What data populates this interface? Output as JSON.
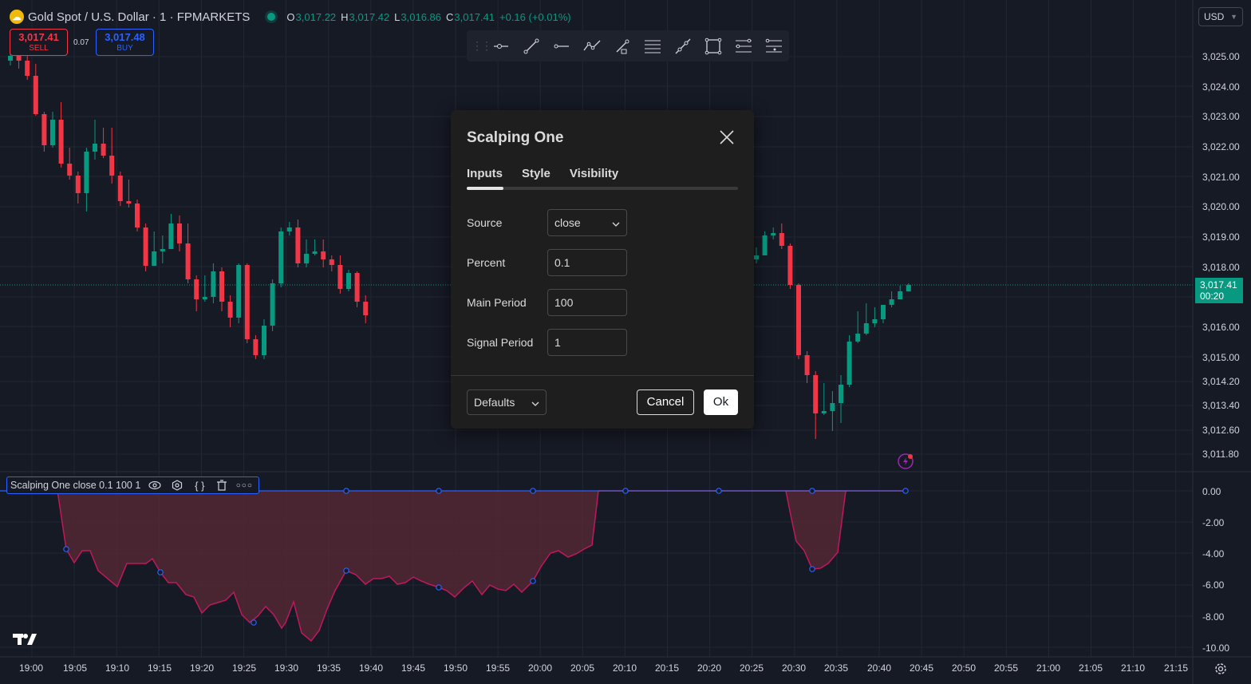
{
  "header": {
    "logo_letter": "☁",
    "title": "Gold Spot / U.S. Dollar · 1 · FPMARKETS",
    "ohlc": [
      {
        "k": "O",
        "v": "3,017.22"
      },
      {
        "k": "H",
        "v": "3,017.42"
      },
      {
        "k": "L",
        "v": "3,016.86"
      },
      {
        "k": "C",
        "v": "3,017.41"
      }
    ],
    "change": "+0.16 (+0.01%)"
  },
  "currency": "USD",
  "trade": {
    "sell_price": "3,017.41",
    "sell_label": "SELL",
    "spread": "0.07",
    "buy_price": "3,017.48",
    "buy_label": "BUY"
  },
  "drawing_toolbar": {
    "tools": [
      "horizontal-ray-icon",
      "trend-line-icon",
      "horizontal-line-icon",
      "path-icon",
      "ray-icon",
      "parallel-channel-icon",
      "extended-line-icon",
      "rectangle-icon",
      "fib-retracement-icon",
      "gann-icon"
    ]
  },
  "price_axis": [
    "3,025.00",
    "3,024.00",
    "3,023.00",
    "3,022.00",
    "3,021.00",
    "3,020.00",
    "3,019.00",
    "3,018.00",
    "3,016.00",
    "3,015.00",
    "3,014.20",
    "3,013.40",
    "3,012.60",
    "3,011.80"
  ],
  "price_tag": {
    "price": "3,017.41",
    "countdown": "00:20"
  },
  "indicator_axis": [
    "0.00",
    "-2.00",
    "-4.00",
    "-6.00",
    "-8.00",
    "-10.00"
  ],
  "time_axis": [
    "19:00",
    "19:05",
    "19:10",
    "19:15",
    "19:20",
    "19:25",
    "19:30",
    "19:35",
    "19:40",
    "19:45",
    "19:50",
    "19:55",
    "20:00",
    "20:05",
    "20:10",
    "20:15",
    "20:20",
    "20:25",
    "20:30",
    "20:35",
    "20:40",
    "20:45",
    "20:50",
    "20:55",
    "21:00",
    "21:05",
    "21:10",
    "21:15"
  ],
  "indicator_legend": {
    "label": "Scalping One close 0.1 100 1"
  },
  "colors": {
    "up": "#089981",
    "down": "#f23645",
    "bg": "#161a25",
    "grid": "#232733",
    "signal": "#2962ff",
    "fill": "#5a2a35"
  },
  "dialog": {
    "title": "Scalping One",
    "tabs": [
      "Inputs",
      "Style",
      "Visibility"
    ],
    "active_tab": "Inputs",
    "inputs": [
      {
        "label": "Source",
        "value": "close",
        "type": "select"
      },
      {
        "label": "Percent",
        "value": "0.1",
        "type": "number"
      },
      {
        "label": "Main Period",
        "value": "100",
        "type": "number"
      },
      {
        "label": "Signal Period",
        "value": "1",
        "type": "number"
      }
    ],
    "defaults_label": "Defaults",
    "cancel_label": "Cancel",
    "ok_label": "Ok"
  }
}
